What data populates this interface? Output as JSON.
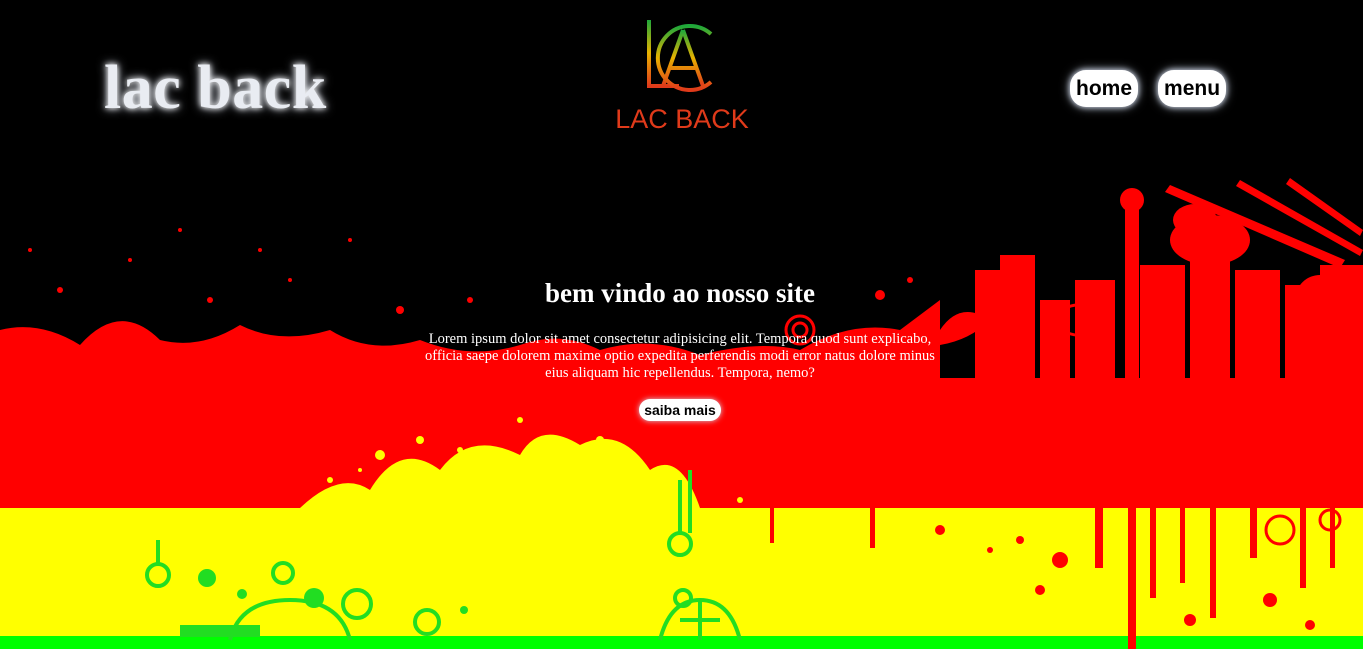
{
  "header": {
    "brand_title": "lac back",
    "logo_text": "LAC BACK"
  },
  "nav": {
    "items": [
      {
        "label": "home"
      },
      {
        "label": "menu"
      }
    ]
  },
  "hero": {
    "heading": "bem vindo ao nosso site",
    "body": "Lorem ipsum dolor sit amet consectetur adipisicing elit. Tempora quod sunt explicabo, officia saepe dolorem maxime optio expedita perferendis modi error natus dolore minus eius aliquam hic repellendus. Tempora, nemo?",
    "cta_label": "saiba mais"
  },
  "colors": {
    "background": "#000000",
    "red_band": "#ff0000",
    "yellow_band": "#ffff00",
    "green_band": "#00ff00",
    "button_bg": "#ffffff"
  }
}
